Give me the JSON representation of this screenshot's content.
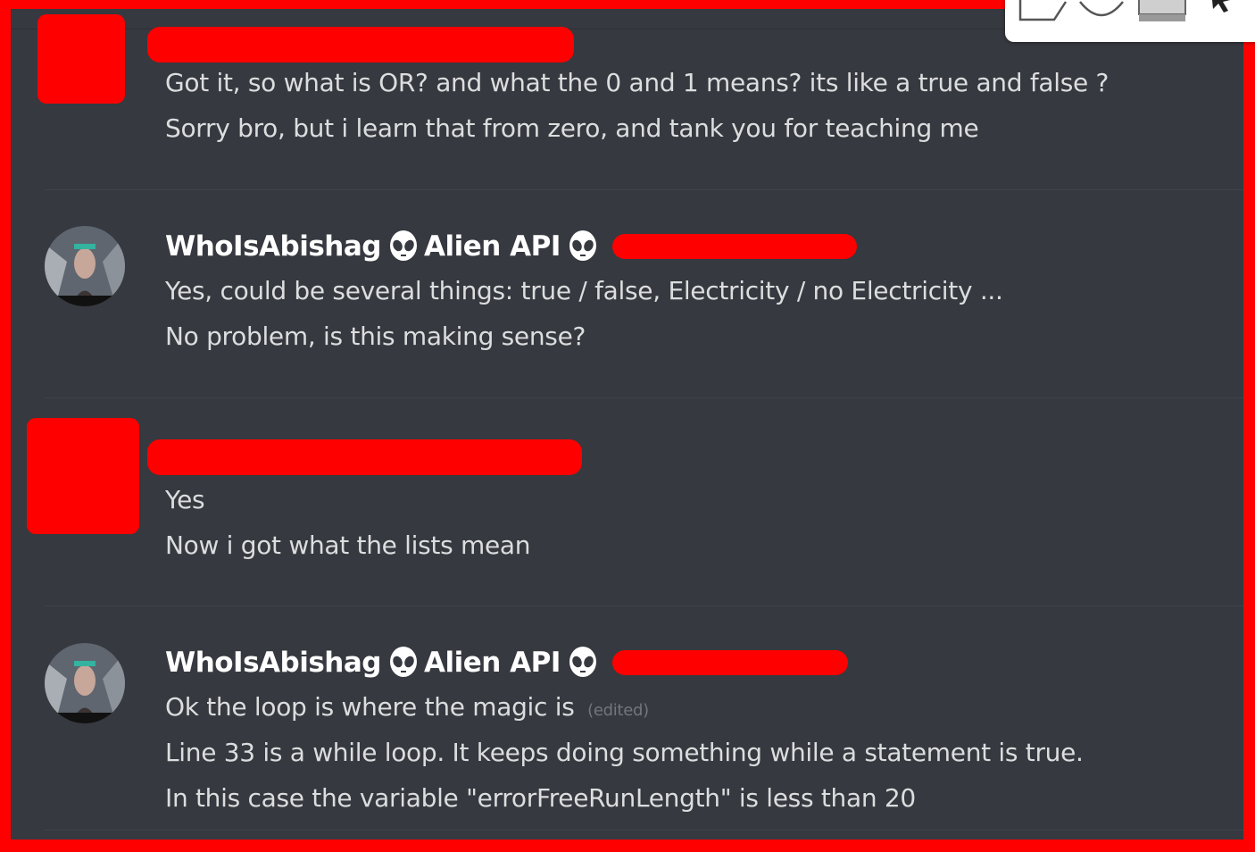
{
  "messages": [
    {
      "author": "",
      "lines": [
        "Got it, so what is OR? and what the 0 and 1 means? its like a true and false ?",
        "Sorry bro, but i learn that from zero, and tank you for teaching me"
      ]
    },
    {
      "author": "WhoIsAbishag",
      "role": "Alien API",
      "lines": [
        "Yes, could be several things: true / false, Electricity / no Electricity ...",
        "No problem, is this making sense?"
      ]
    },
    {
      "author": "",
      "lines": [
        "Yes",
        "Now i got what the lists mean"
      ]
    },
    {
      "author": "WhoIsAbishag",
      "role": "Alien API",
      "lines": [
        "Ok the loop is where the magic is",
        "Line 33 is a while loop. It keeps doing something while a statement is true.",
        "In this case the variable \"errorFreeRunLength\" is less than 20"
      ],
      "edited_label": "(edited)"
    }
  ],
  "colors": {
    "background": "#36393f",
    "text": "#dcddde",
    "username": "#ffffff",
    "muted": "#72767d",
    "redaction": "#ff0000"
  },
  "icons": [
    "alien-icon",
    "rectangle-tool-icon",
    "circle-tool-icon",
    "fill-tool-icon",
    "cursor-icon"
  ]
}
